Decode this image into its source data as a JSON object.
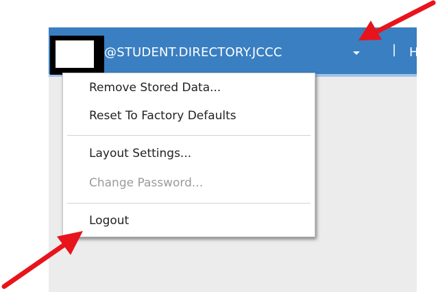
{
  "header": {
    "username_domain": "@STUDENT.DIRECTORY.JCCC",
    "separator": "|",
    "next_item_partial": "H",
    "bar_color": "#3a7fc2"
  },
  "menu": {
    "items": [
      {
        "label": "Remove Stored Data...",
        "enabled": true
      },
      {
        "label": "Reset To Factory Defaults",
        "enabled": true
      },
      {
        "label": "Layout Settings...",
        "enabled": true
      },
      {
        "label": "Change Password...",
        "enabled": false
      },
      {
        "label": "Logout",
        "enabled": true
      }
    ]
  },
  "annotations": {
    "arrow_color": "#e8141c"
  }
}
